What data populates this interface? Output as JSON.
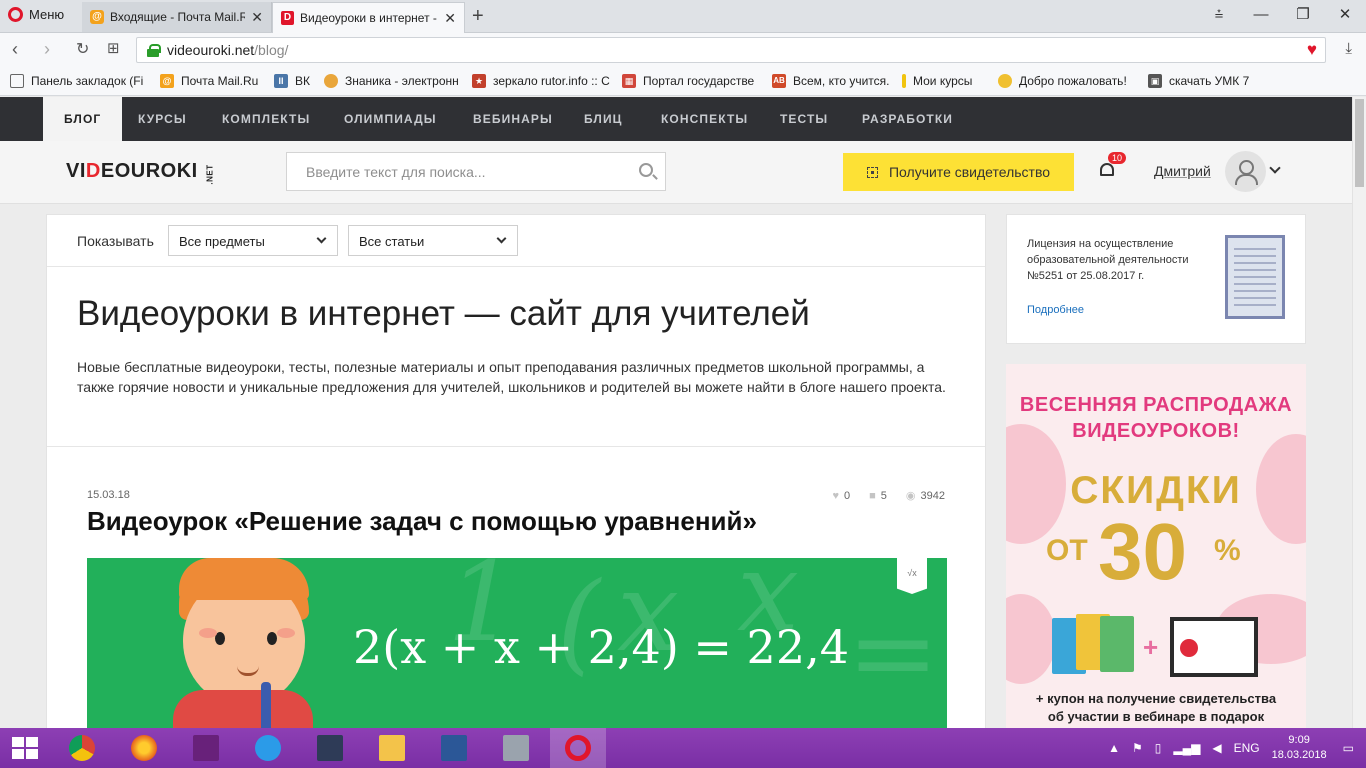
{
  "browser": {
    "menu_label": "Меню",
    "tabs": [
      {
        "label": "Входящие - Почта Mail.Ru"
      },
      {
        "label": "Видеоуроки в интернет -"
      }
    ],
    "url_host": "videouroki.net",
    "url_path": "/blog/",
    "bookmarks": [
      {
        "label": "Панель закладок (Fi"
      },
      {
        "label": "Почта Mail.Ru"
      },
      {
        "label": "ВК"
      },
      {
        "label": "Знаника - электронн"
      },
      {
        "label": "зеркало rutor.info :: С"
      },
      {
        "label": "Портал государстве"
      },
      {
        "label": "Всем, кто учится."
      },
      {
        "label": "Мои курсы"
      },
      {
        "label": "Добро пожаловать!"
      },
      {
        "label": "скачать УМК 7"
      }
    ]
  },
  "site": {
    "nav": [
      "БЛОГ",
      "КУРСЫ",
      "КОМПЛЕКТЫ",
      "ОЛИМПИАДЫ",
      "ВЕБИНАРЫ",
      "БЛИЦ",
      "КОНСПЕКТЫ",
      "ТЕСТЫ",
      "РАЗРАБОТКИ"
    ],
    "logo": {
      "part1": "VI",
      "part_o": "D",
      "part2": "EOUROKI",
      "net": ".NET"
    },
    "search_placeholder": "Введите текст для поиска...",
    "cert_button": "Получите свидетельство",
    "notifications_count": "10",
    "user_name": "Дмитрий"
  },
  "main": {
    "filter_label": "Показывать",
    "filter_subjects": "Все предметы",
    "filter_articles": "Все статьи",
    "title": "Видеоуроки в интернет — сайт для учителей",
    "description": "Новые бесплатные видеоуроки, тесты, полезные материалы и опыт преподавания различных предметов школьной программы, а также горячие новости и уникальные предложения для учителей, школьников и родителей вы можете найти в блоге нашего проекта.",
    "post": {
      "date": "15.03.18",
      "likes": "0",
      "comments": "5",
      "views": "3942",
      "title": "Видеоурок «Решение задач с помощью уравнений»",
      "equation": "2(x + x + 2,4) = 22,4",
      "flag": "√x"
    }
  },
  "sidebar": {
    "license_text": "Лицензия на осуществление образовательной деятельности №5251 от 25.08.2017 г.",
    "license_more": "Подробнее",
    "promo_line1": "ВЕСЕННЯЯ РАСПРОДАЖА",
    "promo_line2": "ВИДЕОУРОКОВ!",
    "promo_discount": "СКИДКИ",
    "promo_from": "ОТ",
    "promo_value": "30",
    "promo_percent": "%",
    "promo_footer1": "+ купон на получение свидетельства",
    "promo_footer2": "об участии в вебинаре в подарок"
  },
  "taskbar": {
    "lang": "ENG",
    "time": "9:09",
    "date": "18.03.2018"
  }
}
